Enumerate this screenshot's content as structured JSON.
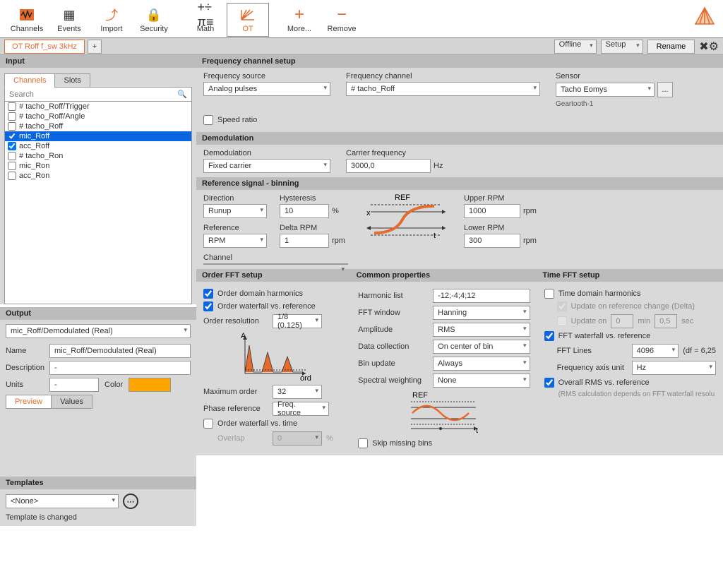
{
  "toolbar": {
    "items": [
      {
        "label": "Channels",
        "icon": "⎍"
      },
      {
        "label": "Events",
        "icon": "☷"
      },
      {
        "label": "Import",
        "icon": "↗"
      },
      {
        "label": "Security",
        "icon": "🔒"
      }
    ],
    "items2": [
      {
        "label": "Math",
        "icon": "π"
      },
      {
        "label": "OT",
        "icon": "✳",
        "sel": true
      }
    ],
    "items3": [
      {
        "label": "More...",
        "icon": "+",
        "color": "#e46b2d"
      },
      {
        "label": "Remove",
        "icon": "−",
        "color": "#e46b2d"
      }
    ]
  },
  "doc_tab": "OT Roff f_sw 3kHz",
  "topright": {
    "mode": "Offline",
    "view": "Setup",
    "rename": "Rename"
  },
  "input": {
    "header": "Input",
    "tabs": [
      "Channels",
      "Slots"
    ],
    "search_ph": "Search",
    "channels": [
      {
        "label": "# tacho_Roff/Trigger",
        "chk": false,
        "sel": false
      },
      {
        "label": "# tacho_Roff/Angle",
        "chk": false,
        "sel": false
      },
      {
        "label": "# tacho_Roff",
        "chk": false,
        "sel": false
      },
      {
        "label": "mic_Roff",
        "chk": true,
        "sel": true
      },
      {
        "label": "acc_Roff",
        "chk": true,
        "sel": false
      },
      {
        "label": "# tacho_Ron",
        "chk": false,
        "sel": false
      },
      {
        "label": "mic_Ron",
        "chk": false,
        "sel": false
      },
      {
        "label": "acc_Ron",
        "chk": false,
        "sel": false
      }
    ]
  },
  "output": {
    "header": "Output",
    "channel": "mic_Roff/Demodulated (Real)",
    "name_lbl": "Name",
    "name": "mic_Roff/Demodulated (Real)",
    "desc_lbl": "Description",
    "desc": "-",
    "units_lbl": "Units",
    "units": "-",
    "color_lbl": "Color",
    "tab_preview": "Preview",
    "tab_values": "Values"
  },
  "templates": {
    "header": "Templates",
    "value": "<None>",
    "changed": "Template is changed"
  },
  "freq_setup": {
    "header": "Frequency channel setup",
    "src_lbl": "Frequency source",
    "src": "Analog pulses",
    "ch_lbl": "Frequency channel",
    "ch": "# tacho_Roff",
    "sensor_lbl": "Sensor",
    "sensor": "Tacho Eomys",
    "sensor_sub": "Geartooth-1",
    "speed_ratio": "Speed ratio"
  },
  "demod": {
    "header": "Demodulation",
    "demod_lbl": "Demodulation",
    "demod": "Fixed carrier",
    "carr_lbl": "Carrier frequency",
    "carr": "3000,0",
    "carr_unit": "Hz"
  },
  "ref": {
    "header": "Reference signal - binning",
    "dir_lbl": "Direction",
    "dir": "Runup",
    "hyst_lbl": "Hysteresis",
    "hyst": "10",
    "hyst_unit": "%",
    "upper_lbl": "Upper RPM",
    "upper": "1000",
    "upper_unit": "rpm",
    "refc_lbl": "Reference",
    "refc": "RPM",
    "delta_lbl": "Delta RPM",
    "delta": "1",
    "delta_unit": "rpm",
    "lower_lbl": "Lower RPM",
    "lower": "300",
    "lower_unit": "rpm",
    "chan_lbl": "Channel"
  },
  "order": {
    "header": "Order FFT setup",
    "odh": "Order domain harmonics",
    "owr": "Order waterfall vs. reference",
    "ores_lbl": "Order resolution",
    "ores": "1/8 (0.125)",
    "max_lbl": "Maximum order",
    "max": "32",
    "phase_lbl": "Phase reference",
    "phase": "Freq. source",
    "owt": "Order waterfall vs. time",
    "overlap_lbl": "Overlap",
    "overlap": "0",
    "overlap_unit": "%"
  },
  "common": {
    "header": "Common properties",
    "harm_lbl": "Harmonic list",
    "harm": "-12;-4;4;12",
    "win_lbl": "FFT window",
    "win": "Hanning",
    "amp_lbl": "Amplitude",
    "amp": "RMS",
    "dc_lbl": "Data collection",
    "dc": "On center of bin",
    "bu_lbl": "Bin update",
    "bu": "Always",
    "sw_lbl": "Spectral weighting",
    "sw": "None",
    "skip": "Skip missing bins"
  },
  "time": {
    "header": "Time FFT setup",
    "tdh": "Time domain harmonics",
    "urc": "Update on reference change (Delta)",
    "uon": "Update on",
    "uon_v1": "0",
    "uon_u1": "min",
    "uon_v2": "0,5",
    "uon_u2": "sec",
    "fwr": "FFT waterfall vs. reference",
    "lines_lbl": "FFT Lines",
    "lines": "4096",
    "df": "(df = 6,25",
    "fau_lbl": "Frequency axis unit",
    "fau": "Hz",
    "orms": "Overall RMS vs. reference",
    "orms_note": "(RMS calculation depends on FFT waterfall resolu"
  }
}
